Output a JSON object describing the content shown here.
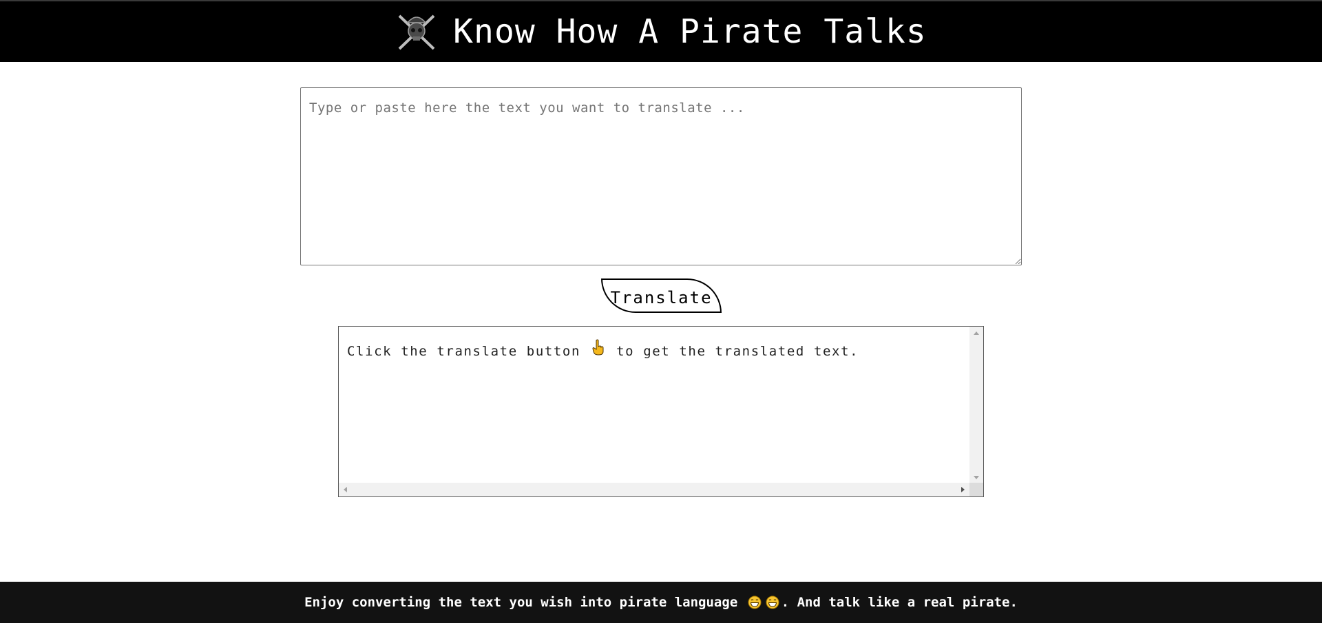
{
  "header": {
    "title": "Know How A Pirate Talks",
    "logo_icon": "pirate-skull-logo-icon",
    "background": "#000000"
  },
  "input": {
    "placeholder": "Type or paste here the text you want to translate ...",
    "value": ""
  },
  "translate_button": {
    "label": "Translate"
  },
  "output": {
    "text_before": "Click the translate button",
    "hand_icon": "pointing-hand-icon",
    "text_after": "to get the translated text."
  },
  "footer": {
    "text_before": "Enjoy converting the text you wish into pirate language",
    "emoji_icon": "grinning-face-icon",
    "text_after": ". And talk like a real pirate.",
    "background": "#121212"
  }
}
